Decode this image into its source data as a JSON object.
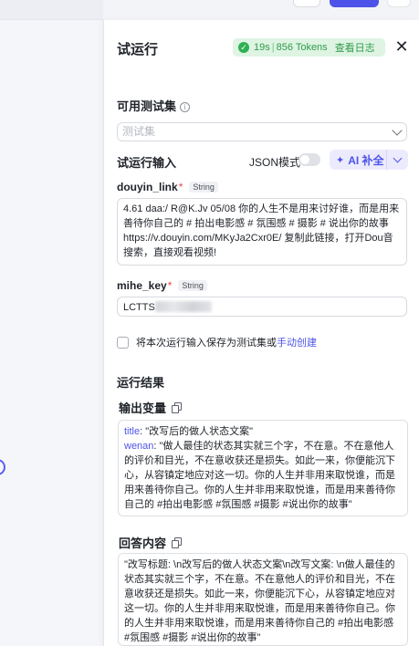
{
  "panel": {
    "title": "试运行",
    "status": {
      "time": "19s",
      "tokens": "856 Tokens",
      "log_link": "查看日志"
    }
  },
  "testset": {
    "label": "可用测试集",
    "placeholder": "测试集"
  },
  "run_input": {
    "label": "试运行输入",
    "json_mode_label": "JSON模式",
    "json_mode_on": false,
    "ai_button_label": "AI 补全",
    "fields": [
      {
        "name": "douyin_link",
        "type": "String",
        "required": "*",
        "value": "4.61 daa:/ R@K.Jv 05/08 你的人生不是用来讨好谁，而是用来善待你自己的 # 拍出电影感 # 氛围感 # 摄影 # 说出你的故事 https://v.douyin.com/MKyJa2Cxr0E/ 复制此链接，打开Dou音搜索，直接观看视频!"
      },
      {
        "name": "mihe_key",
        "type": "String",
        "required": "*",
        "value": "LCTTS"
      }
    ],
    "save_text": "将本次运行输入保存为测试集或",
    "save_link": "手动创建"
  },
  "result": {
    "label": "运行结果",
    "output_vars": {
      "label": "输出变量",
      "title_key": "title",
      "title_value": ": \"改写后的做人状态文案\"",
      "wenan_key": "wenan",
      "wenan_value": ": \"做人最佳的状态其实就三个字，不在意。不在意他人的评价和目光，不在意收获还是损失。如此一来，你便能沉下心，从容镇定地应对这一切。你的人生并非用来取悦谁，而是用来善待你自己。你的人生并非用来取悦谁，而是用来善待你自己的 #拍出电影感 #氛围感 #摄影 #说出你的故事\""
    },
    "answer": {
      "label": "回答内容",
      "value": "\"改写标题: \\n改写后的做人状态文案\\n改写文案: \\n做人最佳的状态其实就三个字，不在意。不在意他人的评价和目光，不在意收获还是损失。如此一来，你便能沉下心，从容镇定地应对这一切。你的人生并非用来取悦谁，而是用来善待你自己。你的人生并非用来取悦谁，而是用来善待你自己的 #拍出电影感 #氛围感 #摄影 #说出你的故事\""
    }
  },
  "colors": {
    "accent": "#4d53e8",
    "success": "#2eb052",
    "success_bg": "#dff4e3",
    "required": "#e5484d"
  }
}
